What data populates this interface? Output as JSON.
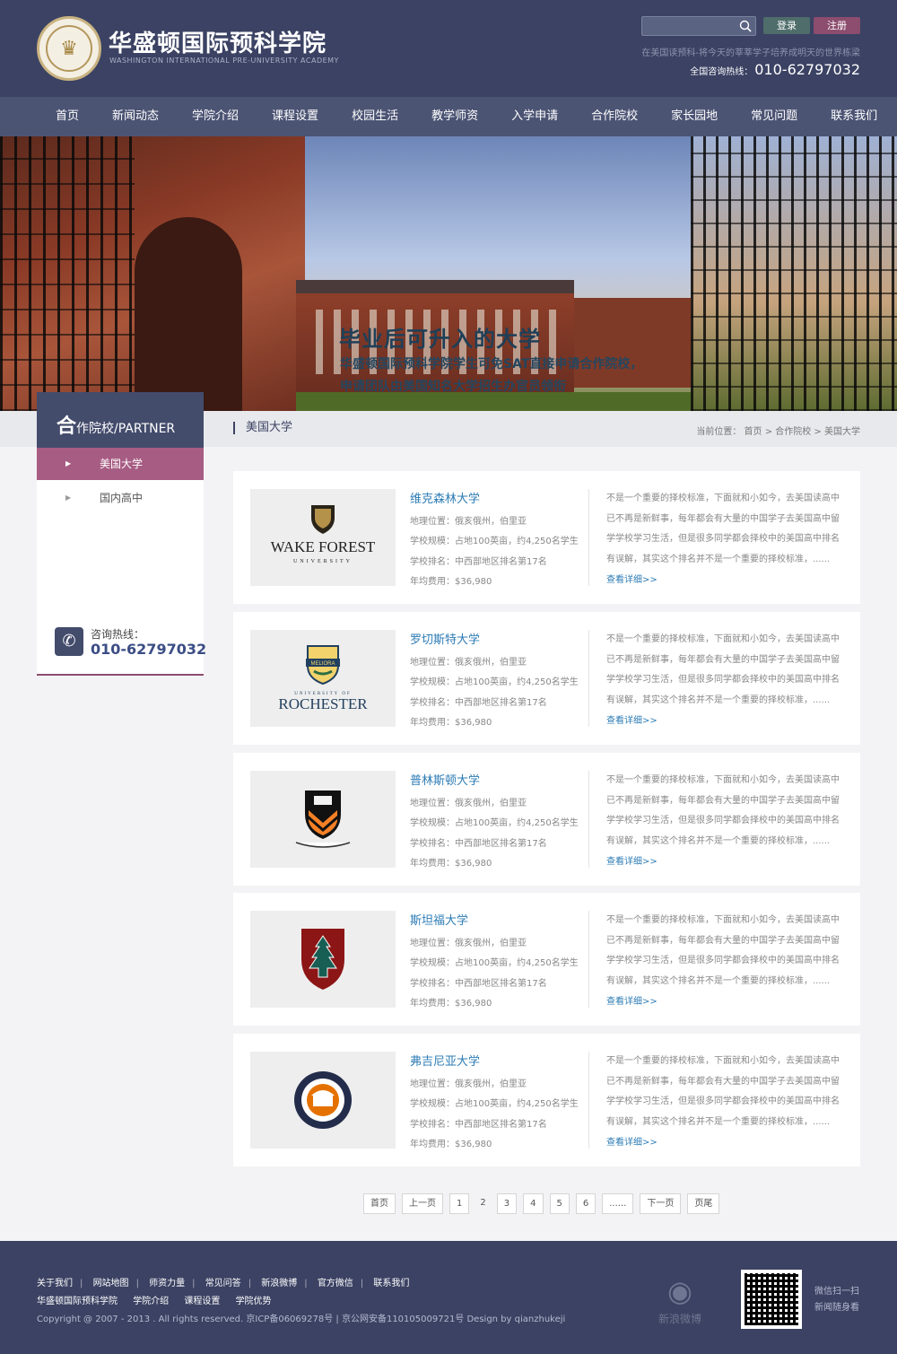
{
  "header": {
    "title_cn": "华盛顿国际预科学院",
    "title_en": "WASHINGTON INTERNATIONAL PRE-UNIVERSITY ACADEMY",
    "search_placeholder": "",
    "login": "登录",
    "register": "注册",
    "slogan": "在美国读预科-将今天的莘莘学子培养成明天的世界栋梁",
    "hotline_label": "全国咨询热线：",
    "hotline_number": "010-62797032"
  },
  "nav": [
    "首页",
    "新闻动态",
    "学院介绍",
    "课程设置",
    "校园生活",
    "教学师资",
    "入学申请",
    "合作院校",
    "家长园地",
    "常见问题",
    "联系我们"
  ],
  "banner": {
    "title": "毕业后可升入的大学",
    "line1": "华盛顿国际预科学院学生可免SAT直接申请合作院校，",
    "line2": "申请团队由美国知名大学招生办官员领衔"
  },
  "sidebar": {
    "head_big": "合",
    "head_rest": "作院校/PARTNER",
    "items": [
      "美国大学",
      "国内高中"
    ],
    "phone_label": "咨询热线：",
    "phone_number": "010-62797032"
  },
  "crumb": {
    "title": "美国大学",
    "path": "当前位置： 首页 > 合作院校 > 美国大学"
  },
  "universities": [
    {
      "name": "维克森林大学",
      "logo": "wake-forest-logo",
      "location": "地理位置：俄亥俄州，伯里亚",
      "size": "学校规模：占地100英亩，约4,250名学生",
      "rank": "学校排名：中西部地区排名第17名",
      "fee": "年均费用：$36,980",
      "desc": "不是一个重要的择校标准，下面就和小如今，去美国读高中已不再是新鲜事，每年都会有大量的中国学子去美国高中留学学校学习生活，但是很多同学都会择校中的美国高中排名有误解，其实这个排名并不是一个重要的择校标准，......",
      "more": "查看详细>>"
    },
    {
      "name": "罗切斯特大学",
      "logo": "rochester-logo",
      "location": "地理位置：俄亥俄州，伯里亚",
      "size": "学校规模：占地100英亩，约4,250名学生",
      "rank": "学校排名：中西部地区排名第17名",
      "fee": "年均费用：$36,980",
      "desc": "不是一个重要的择校标准，下面就和小如今，去美国读高中已不再是新鲜事，每年都会有大量的中国学子去美国高中留学学校学习生活，但是很多同学都会择校中的美国高中排名有误解，其实这个排名并不是一个重要的择校标准，......",
      "more": "查看详细>>"
    },
    {
      "name": "普林斯顿大学",
      "logo": "princeton-logo",
      "location": "地理位置：俄亥俄州，伯里亚",
      "size": "学校规模：占地100英亩，约4,250名学生",
      "rank": "学校排名：中西部地区排名第17名",
      "fee": "年均费用：$36,980",
      "desc": "不是一个重要的择校标准，下面就和小如今，去美国读高中已不再是新鲜事，每年都会有大量的中国学子去美国高中留学学校学习生活，但是很多同学都会择校中的美国高中排名有误解，其实这个排名并不是一个重要的择校标准，......",
      "more": "查看详细>>"
    },
    {
      "name": "斯坦福大学",
      "logo": "stanford-logo",
      "location": "地理位置：俄亥俄州，伯里亚",
      "size": "学校规模：占地100英亩，约4,250名学生",
      "rank": "学校排名：中西部地区排名第17名",
      "fee": "年均费用：$36,980",
      "desc": "不是一个重要的择校标准，下面就和小如今，去美国读高中已不再是新鲜事，每年都会有大量的中国学子去美国高中留学学校学习生活，但是很多同学都会择校中的美国高中排名有误解，其实这个排名并不是一个重要的择校标准，......",
      "more": "查看详细>>"
    },
    {
      "name": "弗吉尼亚大学",
      "logo": "virginia-logo",
      "location": "地理位置：俄亥俄州，伯里亚",
      "size": "学校规模：占地100英亩，约4,250名学生",
      "rank": "学校排名：中西部地区排名第17名",
      "fee": "年均费用：$36,980",
      "desc": "不是一个重要的择校标准，下面就和小如今，去美国读高中已不再是新鲜事，每年都会有大量的中国学子去美国高中留学学校学习生活，但是很多同学都会择校中的美国高中排名有误解，其实这个排名并不是一个重要的择校标准，......",
      "more": "查看详细>>"
    }
  ],
  "pager": [
    "首页",
    "上一页",
    "1",
    "2",
    "3",
    "4",
    "5",
    "6",
    "......",
    "下一页",
    "页尾"
  ],
  "pager_current": "2",
  "footer": {
    "links": [
      "关于我们",
      "网站地图",
      "师资力量",
      "常见问答",
      "新浪微博",
      "官方微信",
      "联系我们"
    ],
    "links2": [
      "华盛顿国际预科学院",
      "学院介绍",
      "课程设置",
      "学院优势"
    ],
    "copyright": "Copyright @ 2007 - 2013 . All rights reserved.   京ICP备06069278号 | 京公网安备110105009721号  Design by qianzhukeji",
    "weibo_label": "新浪微博",
    "qr_text1": "微信扫一扫",
    "qr_text2": "新闻随身看"
  },
  "colors": {
    "header_bg": "#3b4263",
    "accent_pink": "#a75c83",
    "link_blue": "#2d7cb5"
  }
}
